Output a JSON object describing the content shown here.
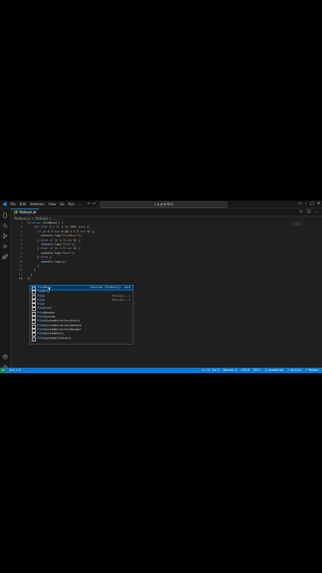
{
  "menu": [
    "File",
    "Edit",
    "Selection",
    "View",
    "Go",
    "Run",
    "..."
  ],
  "search": {
    "text": "p-practice"
  },
  "tab": {
    "label": "fizzbuzz.js",
    "icon": "JS",
    "close": "×"
  },
  "breadcrumb": "fizzbuzz.js > fizzbuzz > ...",
  "gutter": [
    "1",
    "2",
    "3",
    "4",
    "5",
    "6",
    "7",
    "8",
    "9",
    "10",
    "11",
    "12",
    "13",
    "14"
  ],
  "code": [
    [
      [
        "kw2",
        "function "
      ],
      [
        "fn",
        "fizzBuzz"
      ],
      [
        "",
        "() {"
      ]
    ],
    [
      [
        "",
        "    "
      ],
      [
        "kw",
        "for"
      ],
      [
        "",
        " ("
      ],
      [
        "kw2",
        "let"
      ],
      [
        "vr",
        " i"
      ],
      [
        "",
        " = "
      ],
      [
        "nm",
        "1"
      ],
      [
        "",
        "; "
      ],
      [
        "vr",
        "i"
      ],
      [
        "",
        " <= "
      ],
      [
        "nm",
        "100"
      ],
      [
        "",
        "; "
      ],
      [
        "vr",
        "i"
      ],
      [
        "",
        "++) {"
      ]
    ],
    [
      [
        "",
        "      "
      ],
      [
        "kw",
        "if"
      ],
      [
        "",
        " ("
      ],
      [
        "vr",
        "i"
      ],
      [
        "",
        " % "
      ],
      [
        "nm",
        "3"
      ],
      [
        "",
        " === "
      ],
      [
        "nm",
        "0"
      ],
      [
        "",
        " && "
      ],
      [
        "vr",
        "i"
      ],
      [
        "",
        " % "
      ],
      [
        "nm",
        "5"
      ],
      [
        "",
        " === "
      ],
      [
        "nm",
        "0"
      ],
      [
        "",
        ") {"
      ]
    ],
    [
      [
        "",
        "        "
      ],
      [
        "vr",
        "console"
      ],
      [
        "",
        "."
      ],
      [
        "fn",
        "log"
      ],
      [
        "",
        "("
      ],
      [
        "st",
        "\"FizzBuzz\""
      ],
      [
        "",
        ");"
      ]
    ],
    [
      [
        "",
        "      } "
      ],
      [
        "kw",
        "else if"
      ],
      [
        "",
        " ("
      ],
      [
        "vr",
        "i"
      ],
      [
        "",
        " % "
      ],
      [
        "nm",
        "3"
      ],
      [
        "",
        " === "
      ],
      [
        "nm",
        "0"
      ],
      [
        "",
        ") {"
      ]
    ],
    [
      [
        "",
        "        "
      ],
      [
        "vr",
        "console"
      ],
      [
        "",
        "."
      ],
      [
        "fn",
        "log"
      ],
      [
        "",
        "("
      ],
      [
        "st",
        "\"Fizz\""
      ],
      [
        "",
        ");"
      ]
    ],
    [
      [
        "",
        "      } "
      ],
      [
        "kw",
        "else if"
      ],
      [
        "",
        " ("
      ],
      [
        "vr",
        "i"
      ],
      [
        "",
        " % "
      ],
      [
        "nm",
        "5"
      ],
      [
        "",
        " === "
      ],
      [
        "nm",
        "0"
      ],
      [
        "",
        ") {"
      ]
    ],
    [
      [
        "",
        "        "
      ],
      [
        "vr",
        "console"
      ],
      [
        "",
        "."
      ],
      [
        "fn",
        "log"
      ],
      [
        "",
        "("
      ],
      [
        "st",
        "\"Buzz\""
      ],
      [
        "",
        ");"
      ]
    ],
    [
      [
        "",
        "      } "
      ],
      [
        "kw",
        "else"
      ],
      [
        "",
        " {"
      ]
    ],
    [
      [
        "",
        "        "
      ],
      [
        "vr",
        "console"
      ],
      [
        "",
        "."
      ],
      [
        "fn",
        "log"
      ],
      [
        "",
        "("
      ],
      [
        "vr",
        "i"
      ],
      [
        "",
        ");"
      ]
    ],
    [
      [
        "",
        "      }"
      ]
    ],
    [
      [
        "",
        "    }"
      ]
    ],
    [
      [
        "",
        "  }"
      ]
    ],
    [
      [
        "",
        "fi"
      ]
    ]
  ],
  "suggestions": [
    {
      "match": "fi",
      "rest": "zzBuzz",
      "detail": "function fizzBuzz(): void",
      "hint": ""
    },
    {
      "match": "fi",
      "rest": "nally",
      "detail": "",
      "hint": ""
    },
    {
      "match": "Fi",
      "rest": "le",
      "detail": "",
      "hint": "Partial<...>"
    },
    {
      "match": "Fi",
      "rest": "le",
      "detail": "",
      "hint": "Partial<...>"
    },
    {
      "match": "Fi",
      "rest": "le",
      "detail": "",
      "hint": ""
    },
    {
      "match": "Fi",
      "rest": "leList",
      "detail": "",
      "hint": ""
    },
    {
      "match": "Fi",
      "rest": "leReader",
      "detail": "",
      "hint": ""
    },
    {
      "match": "Fi",
      "rest": "leSystem",
      "detail": "",
      "hint": ""
    },
    {
      "match": "Fi",
      "rest": "leSystemDirectoryEntry",
      "detail": "",
      "hint": ""
    },
    {
      "match": "Fi",
      "rest": "leSystemDirectoryHandle",
      "detail": "",
      "hint": ""
    },
    {
      "match": "Fi",
      "rest": "leSystemDirectoryReader",
      "detail": "",
      "hint": ""
    },
    {
      "match": "Fi",
      "rest": "leSystemEntry",
      "detail": "",
      "hint": ""
    },
    {
      "match": "Fi",
      "rest": "leSystemFileEntry",
      "detail": "",
      "hint": ""
    }
  ],
  "status": {
    "errors": "⊗ 0  ⚠ 0",
    "right": [
      "Ln 14, Col 3",
      "Spaces: 2",
      "UTF-8",
      "CRLF",
      "{} JavaScript",
      "⚡ Go Live",
      "✓ Prettier"
    ]
  },
  "colors": {
    "accent": "#0078d4",
    "statusbar": "#0078d4",
    "editor_bg": "#1f1f1f"
  }
}
